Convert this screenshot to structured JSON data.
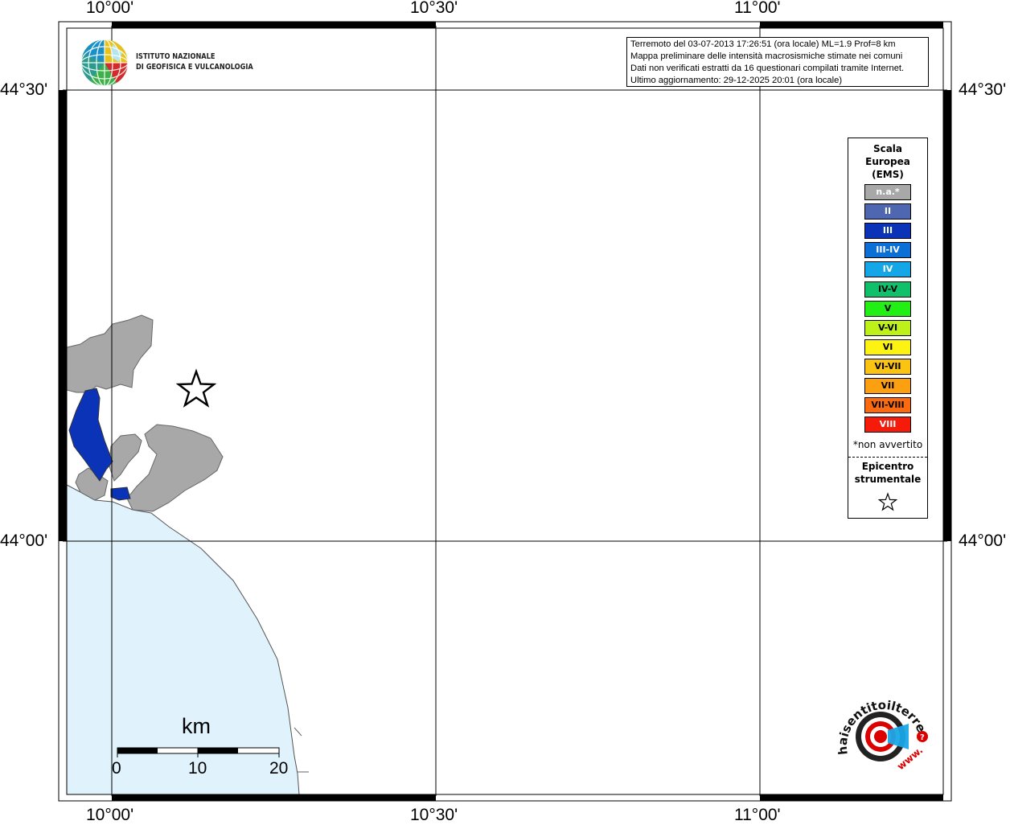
{
  "map": {
    "lon_labels": [
      "10°00'",
      "10°30'",
      "11°00'"
    ],
    "lat_labels": [
      "44°30'",
      "44°00'"
    ]
  },
  "institute": {
    "line1": "ISTITUTO NAZIONALE",
    "line2": "DI GEOFISICA E VULCANOLOGIA"
  },
  "info": {
    "line1": "Terremoto del 03-07-2013 17:26:51 (ora locale) ML=1.9 Prof=8 km",
    "line2": "Mappa preliminare delle intensità macrosismiche stimate nei comuni",
    "line3": "Dati non verificati estratti da 16 questionari compilati tramite Internet.",
    "line4": "Ultimo aggiornamento: 29-12-2025 20:01 (ora locale)"
  },
  "legend": {
    "title_line1": "Scala",
    "title_line2": "Europea",
    "title_line3": "(EMS)",
    "items": [
      {
        "label": "n.a.*",
        "color": "#a8a8a8",
        "text_color": "#ffffff"
      },
      {
        "label": "II",
        "color": "#4f67b0",
        "text_color": "#ffffff"
      },
      {
        "label": "III",
        "color": "#0a33b7",
        "text_color": "#ffffff"
      },
      {
        "label": "III-IV",
        "color": "#0b6fd6",
        "text_color": "#ffffff"
      },
      {
        "label": "IV",
        "color": "#14a6e6",
        "text_color": "#ffffff"
      },
      {
        "label": "IV-V",
        "color": "#11c06a",
        "text_color": "#000000"
      },
      {
        "label": "V",
        "color": "#22f014",
        "text_color": "#000000"
      },
      {
        "label": "V-VI",
        "color": "#bef01a",
        "text_color": "#000000"
      },
      {
        "label": "VI",
        "color": "#fcf312",
        "text_color": "#000000"
      },
      {
        "label": "VI-VII",
        "color": "#fcc412",
        "text_color": "#000000"
      },
      {
        "label": "VII",
        "color": "#fca012",
        "text_color": "#000000"
      },
      {
        "label": "VII-VIII",
        "color": "#fc6a10",
        "text_color": "#000000"
      },
      {
        "label": "VIII",
        "color": "#f51a0a",
        "text_color": "#ffffff"
      }
    ],
    "note": "*non avvertito",
    "epicenter_line1": "Epicentro",
    "epicenter_line2": "strumentale"
  },
  "scalebar": {
    "unit": "km",
    "ticks": [
      "0",
      "10",
      "20"
    ]
  },
  "colors": {
    "sea": "#e0f2fc",
    "na_area": "#a8a8a8",
    "intensity_III": "#0a33b7"
  },
  "watermark": {
    "text": "haisentitoilterremoto.it",
    "www": "www."
  }
}
